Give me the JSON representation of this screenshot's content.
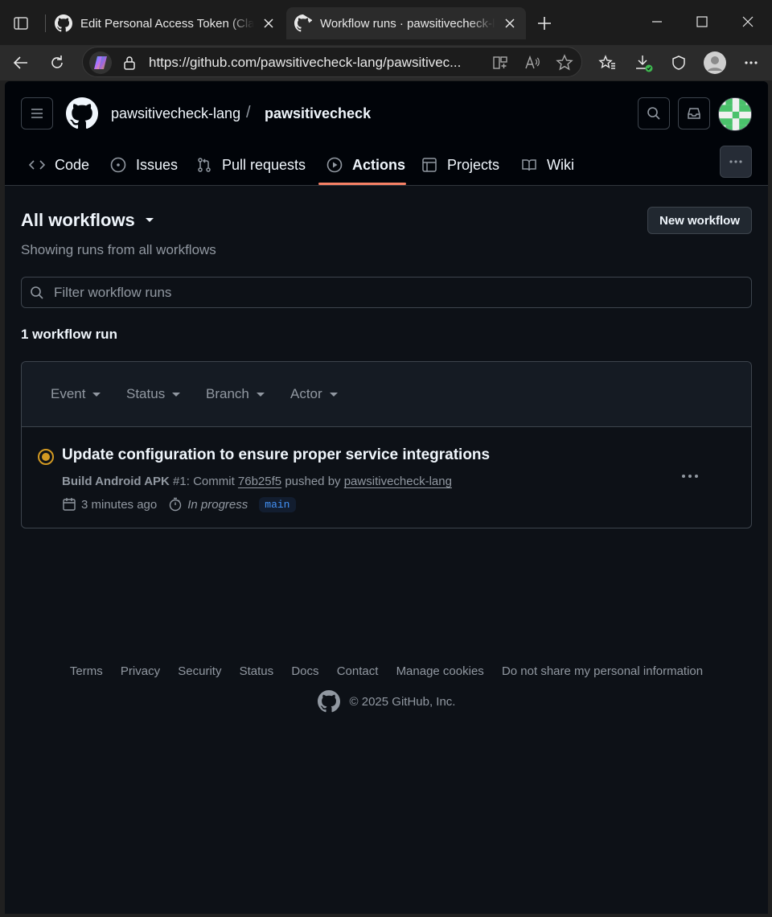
{
  "browser": {
    "tabs": [
      {
        "label": "Edit Personal Access Token (Classic)",
        "active": false
      },
      {
        "label": "Workflow runs · pawsitivecheck-lang/pawsitivecheck",
        "active": true
      }
    ],
    "url": "https://github.com/pawsitivecheck-lang/pawsitivec..."
  },
  "header": {
    "owner": "pawsitivecheck-lang",
    "separator": "/",
    "repo": "pawsitivecheck"
  },
  "nav": {
    "items": [
      {
        "label": "Code",
        "icon": "code-icon"
      },
      {
        "label": "Issues",
        "icon": "issue-icon"
      },
      {
        "label": "Pull requests",
        "icon": "pull-request-icon"
      },
      {
        "label": "Actions",
        "icon": "play-icon"
      },
      {
        "label": "Projects",
        "icon": "table-icon"
      },
      {
        "label": "Wiki",
        "icon": "book-icon"
      }
    ],
    "active": "Actions"
  },
  "main": {
    "title": "All workflows",
    "subtitle": "Showing runs from all workflows",
    "new_workflow_label": "New workflow",
    "filter_placeholder": "Filter workflow runs",
    "count_label": "1 workflow run",
    "filters": [
      "Event",
      "Status",
      "Branch",
      "Actor"
    ],
    "runs": [
      {
        "title": "Update configuration to ensure proper service integrations",
        "workflow": "Build Android APK",
        "run_number": "#1",
        "commit_prefix": ": Commit",
        "commit": "76b25f5",
        "pushed_by_label": "pushed by",
        "actor": "pawsitivecheck-lang",
        "time": "3 minutes ago",
        "status": "In progress",
        "branch": "main",
        "status_color": "#d29922"
      }
    ]
  },
  "footer": {
    "links": [
      "Terms",
      "Privacy",
      "Security",
      "Status",
      "Docs",
      "Contact",
      "Manage cookies",
      "Do not share my personal information"
    ],
    "copyright": "© 2025 GitHub, Inc."
  },
  "colors": {
    "page_bg": "#0d1117",
    "header_bg": "#010409",
    "accent_underline": "#f78166",
    "branch_text": "#4493f8"
  }
}
